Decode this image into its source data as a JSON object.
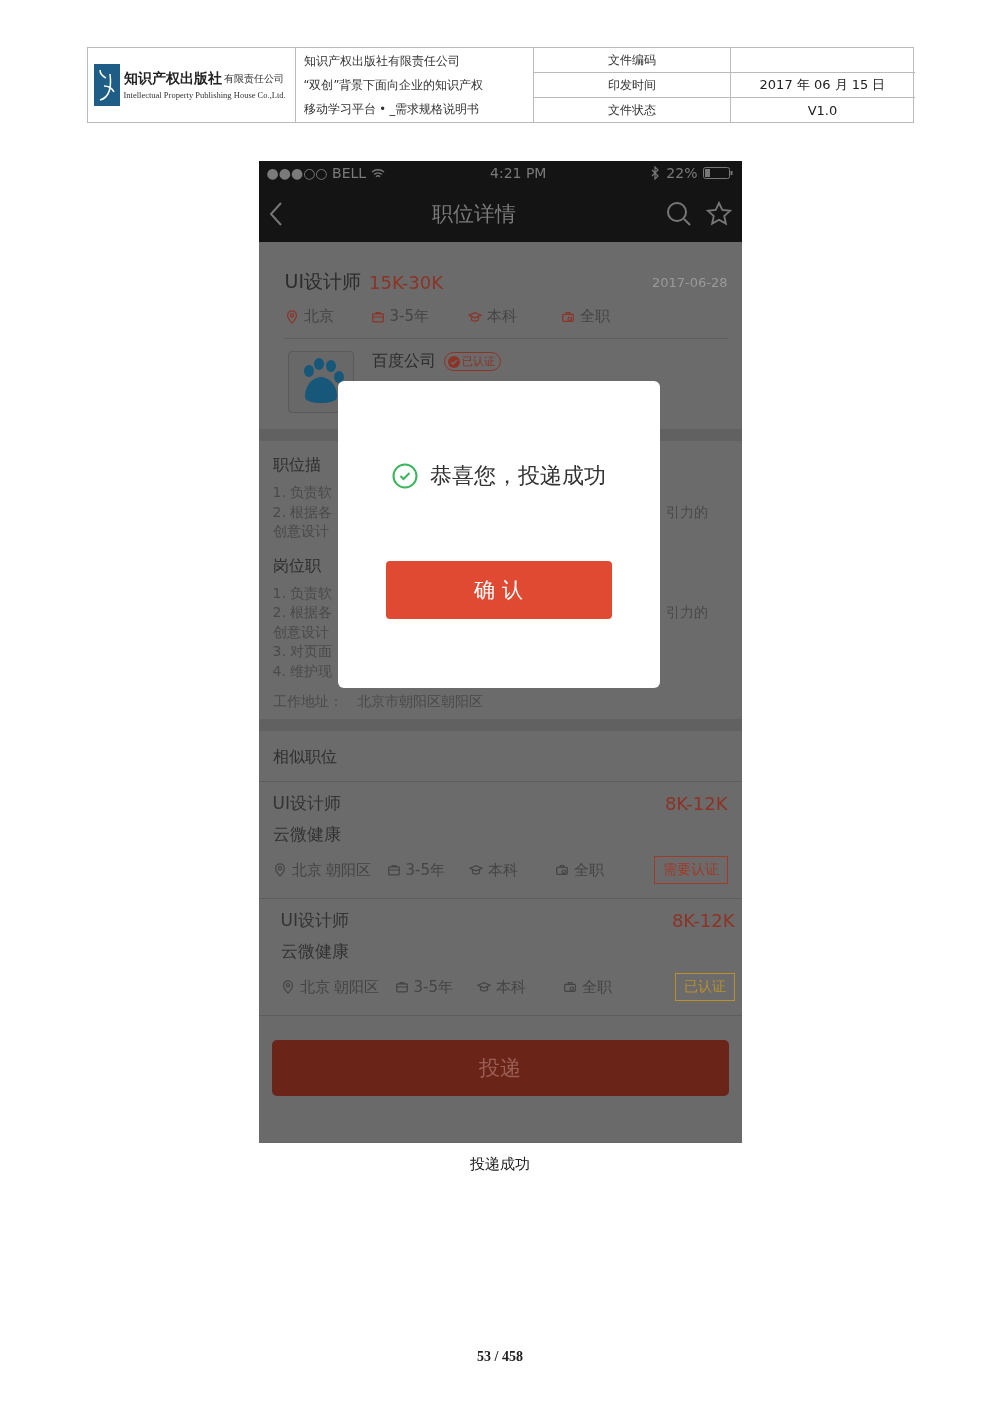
{
  "doc_header": {
    "company_cn": "知识产权出版社",
    "company_suffix": "有限责任公司",
    "company_en": "Intellectual Property Publishing House Co.,Ltd.",
    "title_lines": [
      "知识产权出版社有限责任公司",
      "“双创”背景下面向企业的知识产权",
      "移动学习平台 • _需求规格说明书"
    ],
    "fields": [
      {
        "label": "文件编码"
      },
      {
        "label": "印发时间",
        "value": "2017 年 06 月 15 日"
      },
      {
        "label": "文件状态",
        "value": "V1.0"
      }
    ]
  },
  "phone": {
    "status_bar": {
      "carrier": "●●●○○ BELL",
      "time": "4:21 PM",
      "battery": "22%"
    },
    "nav": {
      "title": "职位详情"
    },
    "job": {
      "title": "UI设计师",
      "salary": "15K-30K",
      "date": "2017-06-28",
      "tags": [
        {
          "kind": "location",
          "text": "北京"
        },
        {
          "kind": "experience",
          "text": "3-5年"
        },
        {
          "kind": "education",
          "text": "本科"
        },
        {
          "kind": "type",
          "text": "全职"
        }
      ]
    },
    "company": {
      "name": "百度公司",
      "badge": "已认证"
    },
    "sections": [
      {
        "title": "职位描",
        "lines": [
          {
            "left": "1. 负责软"
          },
          {
            "left": "2. 根据各",
            "right": "引力的"
          },
          {
            "left": "创意设计"
          }
        ]
      },
      {
        "title": "岗位职",
        "lines": [
          {
            "left": "1. 负责软"
          },
          {
            "left": "2. 根据各",
            "right": "引力的"
          },
          {
            "left": "创意设计"
          },
          {
            "left": "3. 对页面"
          },
          {
            "left": "4. 维护现"
          }
        ]
      }
    ],
    "address": {
      "label": "工作地址：",
      "value": "北京市朝阳区朝阳区"
    },
    "similar": {
      "title": "相似职位",
      "items": [
        {
          "title": "UI设计师",
          "salary": "8K-12K",
          "company": "云微健康",
          "tags": [
            {
              "kind": "location",
              "text": "北京 朝阳区"
            },
            {
              "kind": "experience",
              "text": "3-5年"
            },
            {
              "kind": "education",
              "text": "本科"
            },
            {
              "kind": "type",
              "text": "全职"
            }
          ],
          "badge": {
            "kind": "pending",
            "text": "需要认证"
          }
        },
        {
          "title": "UI设计师",
          "salary": "8K-12K",
          "company": "云微健康",
          "tags": [
            {
              "kind": "location",
              "text": "北京 朝阳区"
            },
            {
              "kind": "experience",
              "text": "3-5年"
            },
            {
              "kind": "education",
              "text": "本科"
            },
            {
              "kind": "type",
              "text": "全职"
            }
          ],
          "badge": {
            "kind": "verified",
            "text": "已认证"
          }
        }
      ]
    },
    "apply_button": "投递",
    "dialog": {
      "message": "恭喜您，投递成功",
      "confirm": "确 认"
    }
  },
  "caption": "投递成功",
  "page_number": "53 / 458"
}
